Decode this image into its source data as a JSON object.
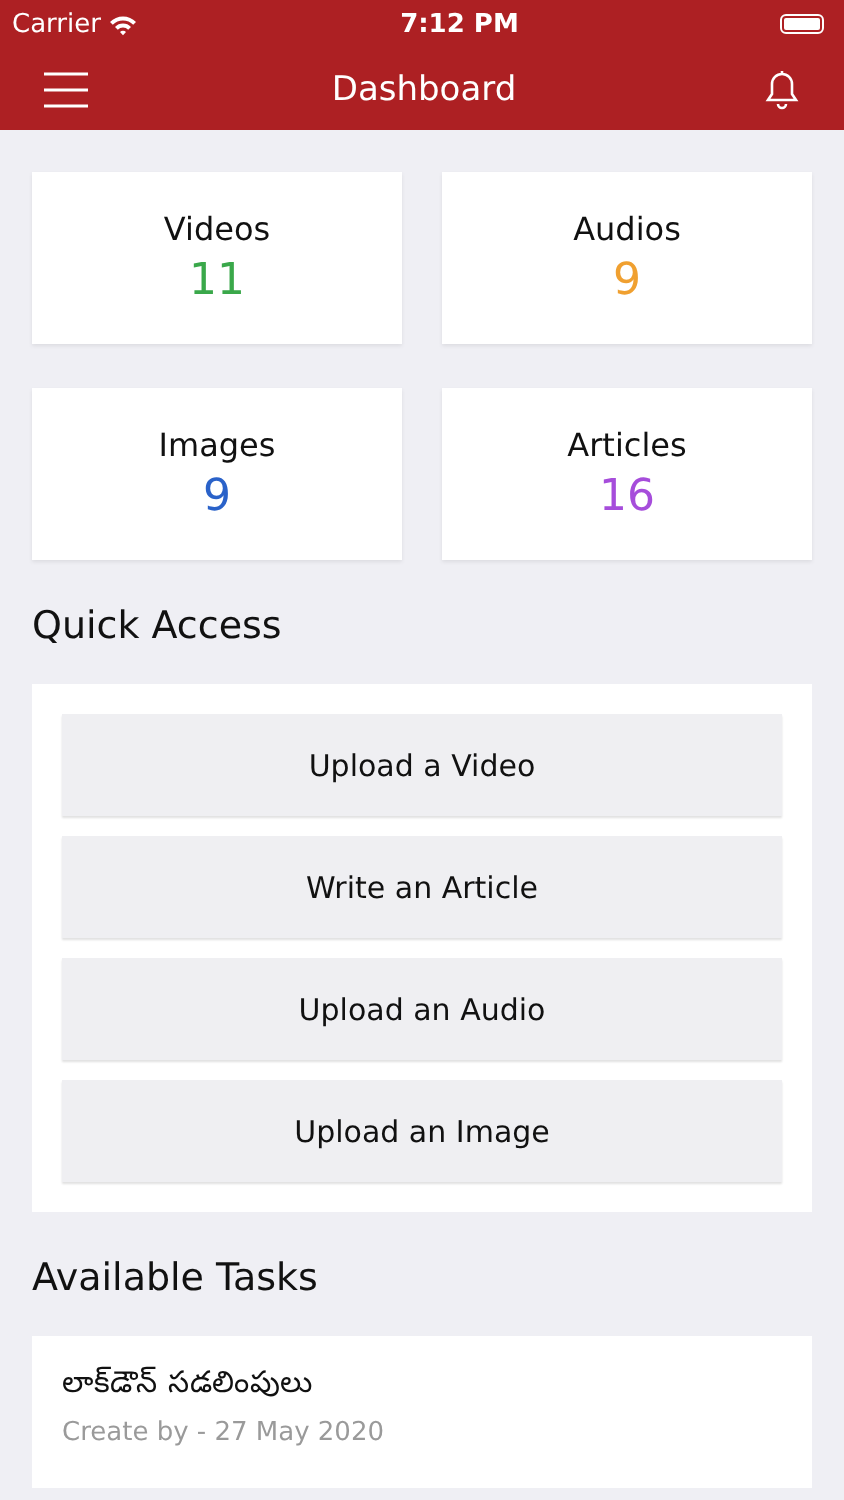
{
  "status_bar": {
    "carrier": "Carrier",
    "time": "7:12 PM"
  },
  "header": {
    "title": "Dashboard"
  },
  "stats": [
    {
      "label": "Videos",
      "count": "11",
      "color": "#3aa84a"
    },
    {
      "label": "Audios",
      "count": "9",
      "color": "#f0a030"
    },
    {
      "label": "Images",
      "count": "9",
      "color": "#2a62c9"
    },
    {
      "label": "Articles",
      "count": "16",
      "color": "#a64ddb"
    }
  ],
  "quick_access": {
    "title": "Quick Access",
    "buttons": [
      "Upload a Video",
      "Write an Article",
      "Upload an Audio",
      "Upload an Image"
    ]
  },
  "tasks": {
    "title": "Available Tasks",
    "items": [
      {
        "title": "లాక్‌డౌన్ సడలింపులు",
        "meta": "Create by - 27 May 2020"
      }
    ]
  }
}
